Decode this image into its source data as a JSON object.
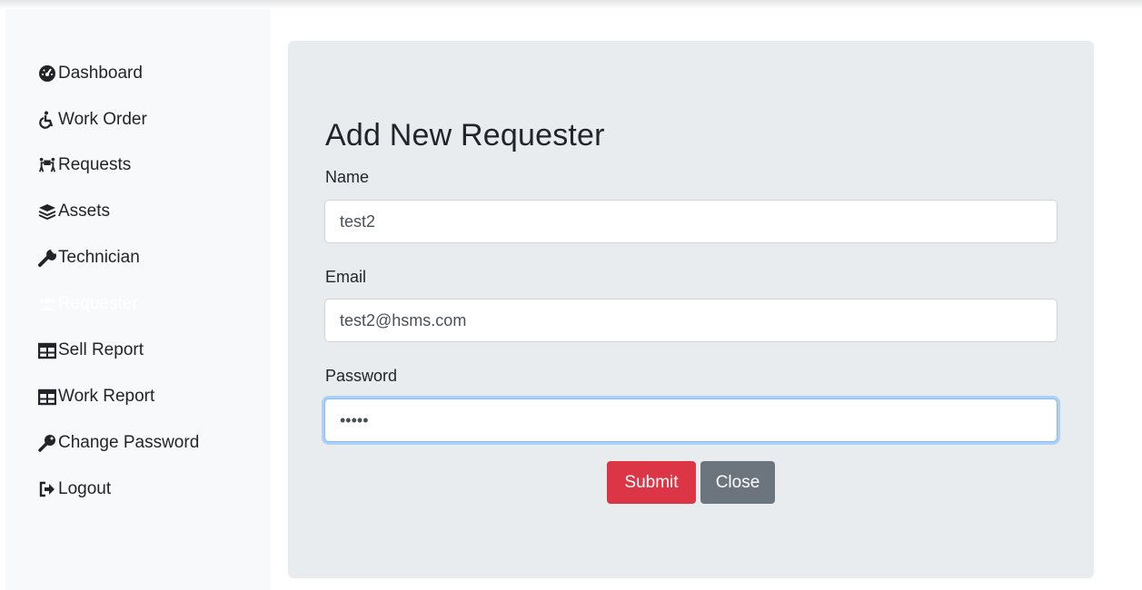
{
  "sidebar": {
    "items": [
      {
        "label": "Dashboard",
        "icon": "tachometer-icon"
      },
      {
        "label": "Work Order",
        "icon": "wheelchair-icon"
      },
      {
        "label": "Requests",
        "icon": "people-carry-icon"
      },
      {
        "label": "Assets",
        "icon": "layers-icon"
      },
      {
        "label": "Technician",
        "icon": "wrench-icon"
      },
      {
        "label": "Requester",
        "icon": "users-icon",
        "active": true
      },
      {
        "label": "Sell Report",
        "icon": "table-icon"
      },
      {
        "label": "Work Report",
        "icon": "table-icon"
      },
      {
        "label": "Change Password",
        "icon": "key-icon"
      },
      {
        "label": "Logout",
        "icon": "sign-out-icon"
      }
    ]
  },
  "form": {
    "title": "Add New Requester",
    "name_label": "Name",
    "name_value": "test2",
    "email_label": "Email",
    "email_value": "test2@hsms.com",
    "password_label": "Password",
    "password_value": "12345",
    "submit_label": "Submit",
    "close_label": "Close"
  },
  "colors": {
    "submit": "#dc3545",
    "close": "#6c757d",
    "panel": "#e9ecef",
    "sidebar": "#f8f9fa",
    "focus": "#80bdff"
  }
}
